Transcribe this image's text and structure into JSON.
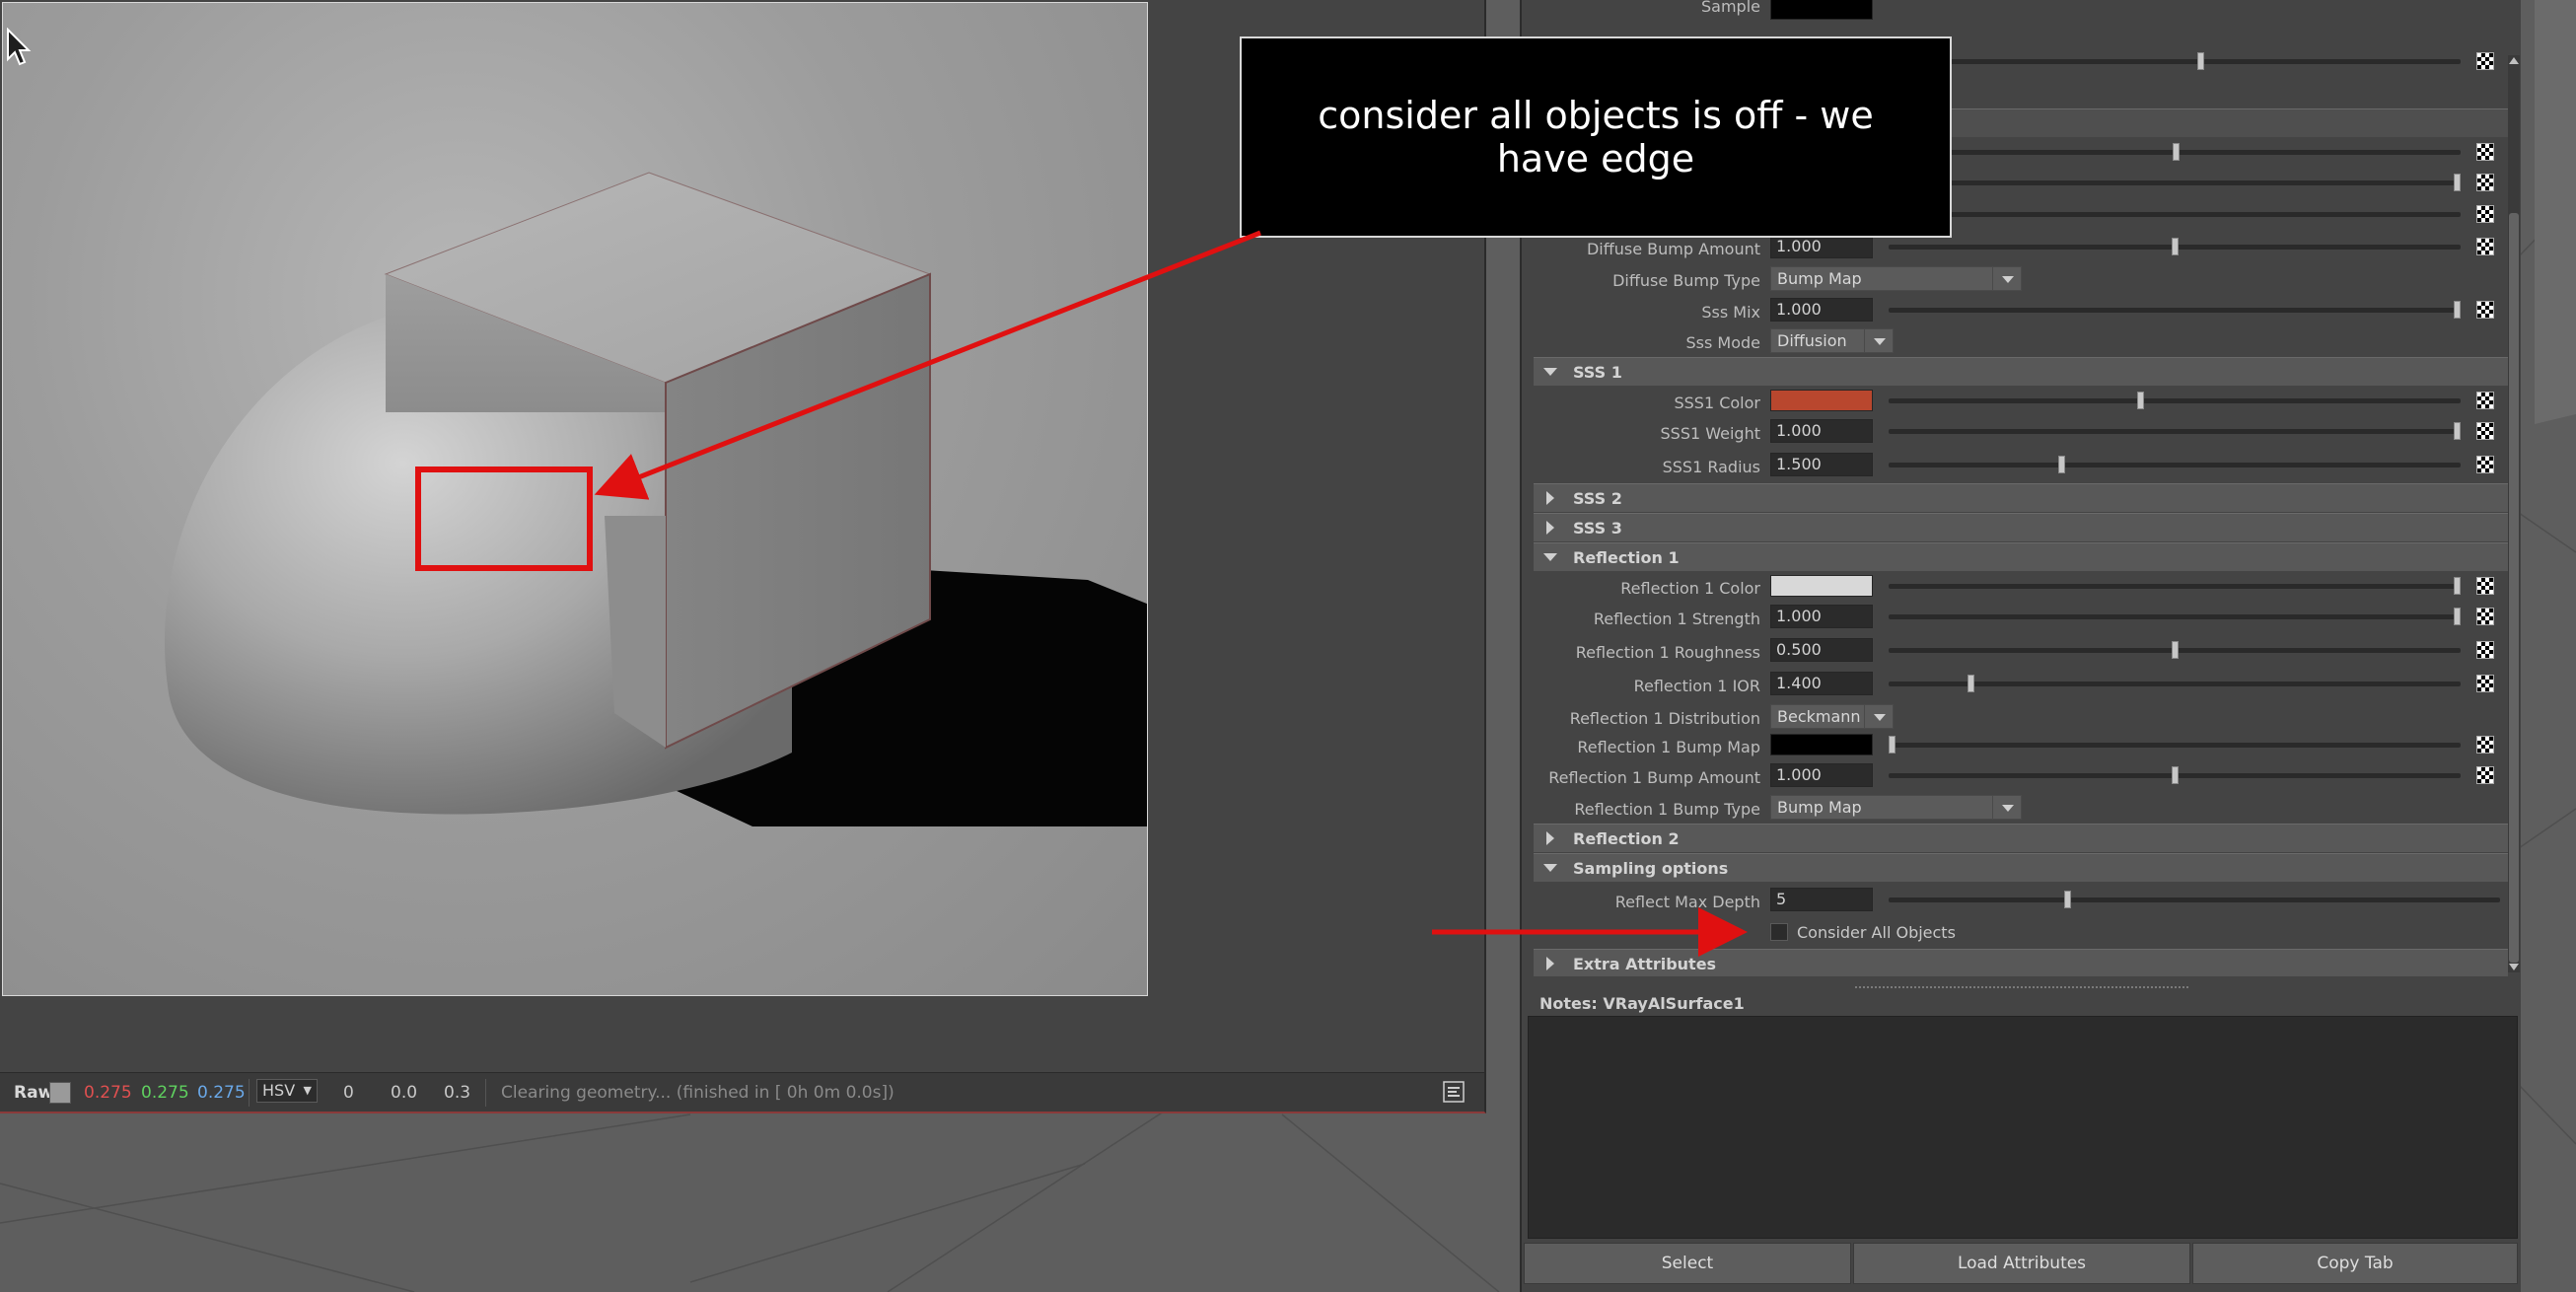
{
  "render_view": {
    "status": {
      "mode_label": "Raw",
      "r": "0.275",
      "g": "0.275",
      "b": "0.275",
      "color_space": "HSV",
      "h": "0",
      "s": "0.0",
      "v": "0.3",
      "message": "Clearing geometry... (finished in [ 0h  0m  0.0s])"
    }
  },
  "callout": {
    "text": "consider all objects is off - we have edge"
  },
  "attribute_editor": {
    "top_cut_label": "Sample",
    "rows": {
      "diffuse_bump_amount": {
        "label": "Diffuse Bump Amount",
        "value": "1.000",
        "slider": 0.5
      },
      "diffuse_bump_type": {
        "label": "Diffuse Bump Type",
        "value": "Bump Map"
      },
      "sss_mix": {
        "label": "Sss Mix",
        "value": "1.000",
        "slider": 1.0
      },
      "sss_mode": {
        "label": "Sss Mode",
        "value": "Diffusion"
      },
      "sss1_color": {
        "label": "SSS1 Color",
        "color": "#b9472e",
        "slider": 0.44
      },
      "sss1_weight": {
        "label": "SSS1 Weight",
        "value": "1.000",
        "slider": 1.0
      },
      "sss1_radius": {
        "label": "SSS1 Radius",
        "value": "1.500",
        "slider": 0.3
      },
      "refl1_color": {
        "label": "Reflection 1 Color",
        "color": "#d8d8d8",
        "slider": 1.0
      },
      "refl1_strength": {
        "label": "Reflection 1 Strength",
        "value": "1.000",
        "slider": 1.0
      },
      "refl1_roughness": {
        "label": "Reflection 1 Roughness",
        "value": "0.500",
        "slider": 0.5
      },
      "refl1_ior": {
        "label": "Reflection 1 IOR",
        "value": "1.400",
        "slider": 0.14
      },
      "refl1_distribution": {
        "label": "Reflection 1 Distribution",
        "value": "Beckmann"
      },
      "refl1_bump_map": {
        "label": "Reflection 1 Bump Map",
        "color": "#000000",
        "slider": 0.0
      },
      "refl1_bump_amount": {
        "label": "Reflection 1 Bump Amount",
        "value": "1.000",
        "slider": 0.5
      },
      "refl1_bump_type": {
        "label": "Reflection 1 Bump Type",
        "value": "Bump Map"
      },
      "reflect_max_depth": {
        "label": "Reflect Max Depth",
        "value": "5",
        "slider": 0.29
      },
      "consider_all_objects": {
        "label": "Consider All Objects",
        "checked": false
      }
    },
    "sections": {
      "sss1": "SSS 1",
      "sss2": "SSS 2",
      "sss3": "SSS 3",
      "reflection1": "Reflection 1",
      "reflection2": "Reflection 2",
      "sampling": "Sampling options",
      "extra": "Extra Attributes"
    },
    "notes_label": "Notes:  VRayAlSurface1",
    "buttons": {
      "select": "Select",
      "load_attributes": "Load Attributes",
      "copy_tab": "Copy Tab"
    }
  },
  "colors": {
    "annotation_red": "#e01010",
    "accent_sss": "#b9472e"
  }
}
